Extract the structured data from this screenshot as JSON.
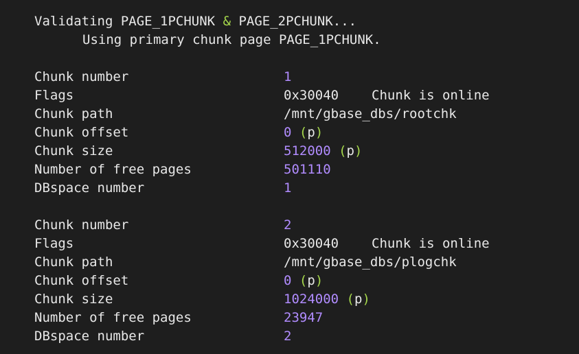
{
  "header": {
    "validating_prefix": "Validating ",
    "page1": "PAGE_1PCHUNK",
    "amp": "&",
    "page2": "PAGE_2PCHUNK...",
    "using_line": "Using primary chunk page PAGE_1PCHUNK."
  },
  "labels": {
    "chunk_number": "Chunk number",
    "flags": "Flags",
    "chunk_path": "Chunk path",
    "chunk_offset": "Chunk offset",
    "chunk_size": "Chunk size",
    "free_pages": "Number of free pages",
    "dbspace_number": "DBspace number",
    "paren_open": "(",
    "p": "p",
    "paren_close": ")"
  },
  "chunks": [
    {
      "number": "1",
      "flags": "0x30040",
      "flags_desc": "Chunk is online",
      "path": "/mnt/gbase_dbs/rootchk",
      "offset": "0",
      "size": "512000",
      "free_pages": "501110",
      "dbspace": "1"
    },
    {
      "number": "2",
      "flags": "0x30040",
      "flags_desc": "Chunk is online",
      "path": "/mnt/gbase_dbs/plogchk",
      "offset": "0",
      "size": "1024000",
      "free_pages": "23947",
      "dbspace": "2"
    }
  ]
}
